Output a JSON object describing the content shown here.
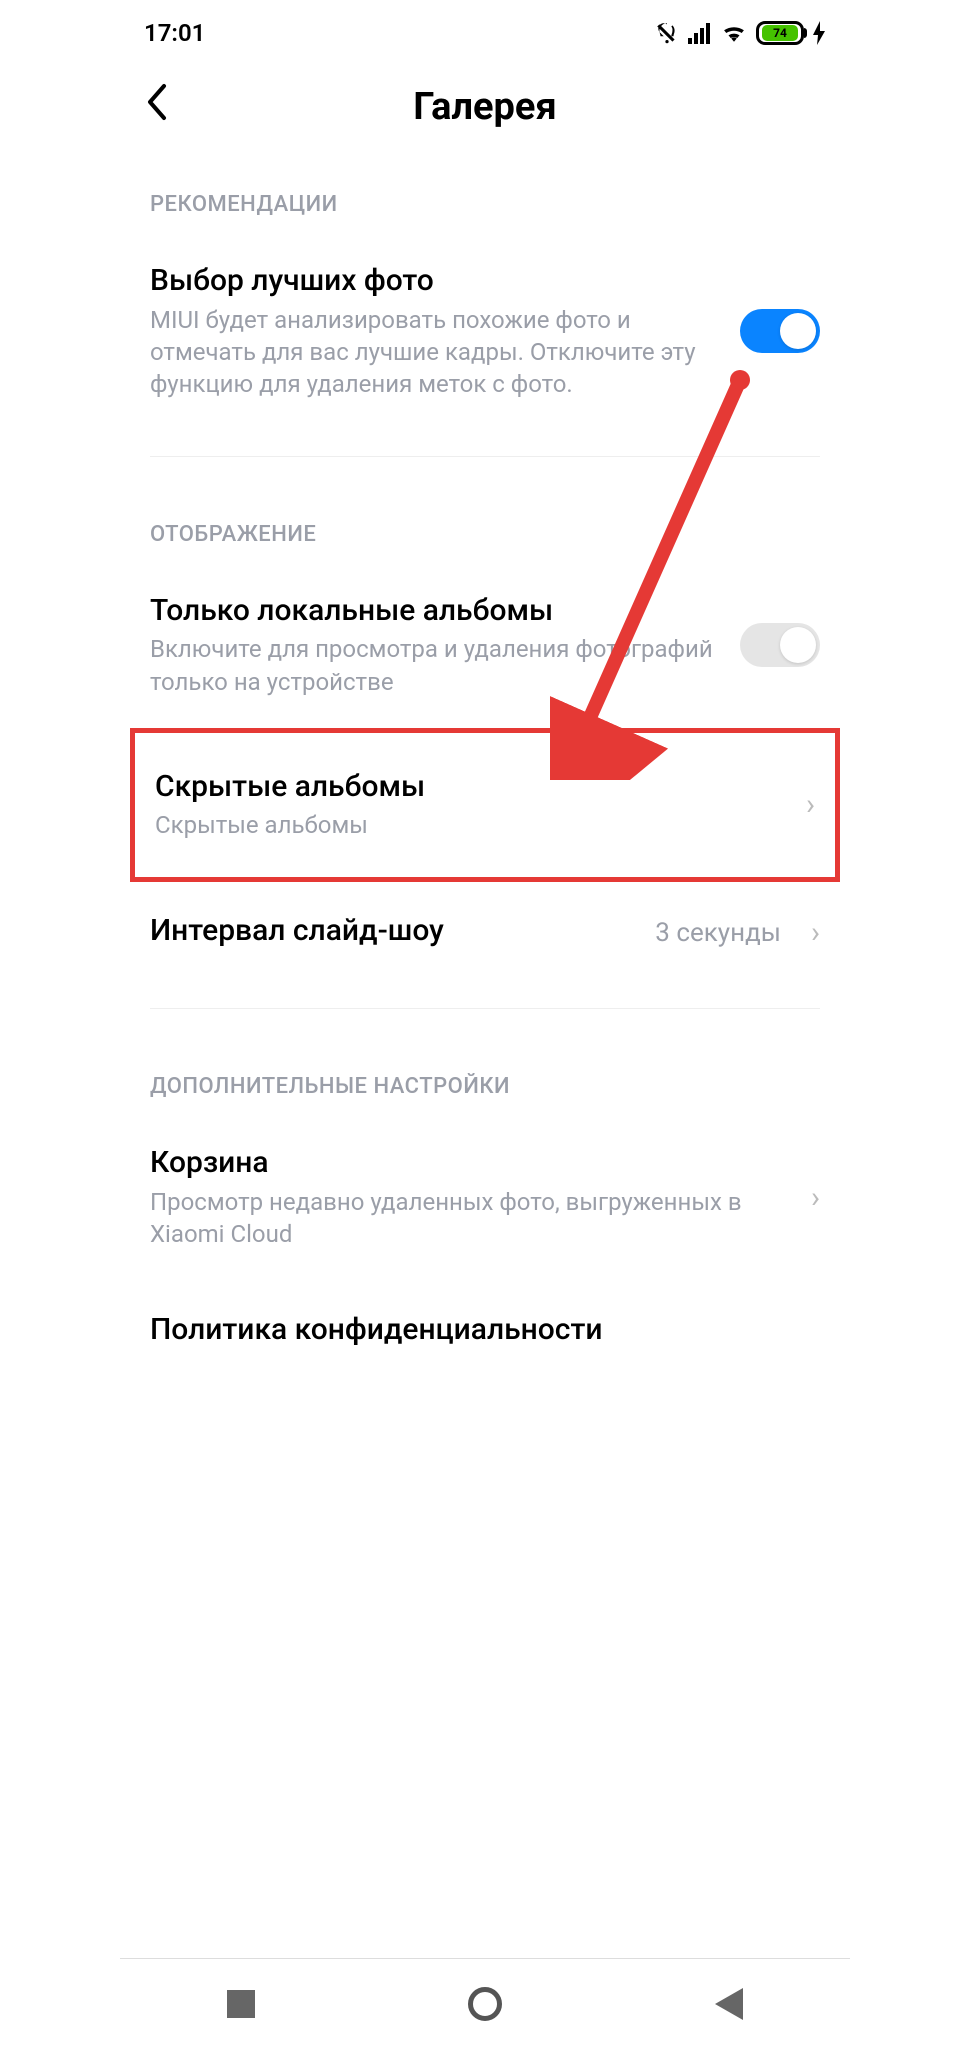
{
  "status": {
    "time": "17:01",
    "battery_percent": "74"
  },
  "header": {
    "title": "Галерея"
  },
  "sections": {
    "recommendations": {
      "label": "РЕКОМЕНДАЦИИ",
      "best_photos": {
        "title": "Выбор лучших фото",
        "sub": "MIUI будет анализировать похожие фото и отмечать для вас лучшие кадры. Отключите эту функцию для удаления меток с фото."
      }
    },
    "display": {
      "label": "ОТОБРАЖЕНИЕ",
      "local_only": {
        "title": "Только локальные альбомы",
        "sub": "Включите для просмотра и удаления фотографий только на устройстве"
      },
      "hidden_albums": {
        "title": "Скрытые альбомы",
        "sub": "Скрытые альбомы"
      },
      "slideshow": {
        "title": "Интервал слайд-шоу",
        "value": "3 секунды"
      }
    },
    "advanced": {
      "label": "ДОПОЛНИТЕЛЬНЫЕ НАСТРОЙКИ",
      "trash": {
        "title": "Корзина",
        "sub": "Просмотр недавно удаленных фото, выгруженных в Xiaomi Cloud"
      },
      "privacy": {
        "title": "Политика конфиденциальности"
      }
    }
  }
}
